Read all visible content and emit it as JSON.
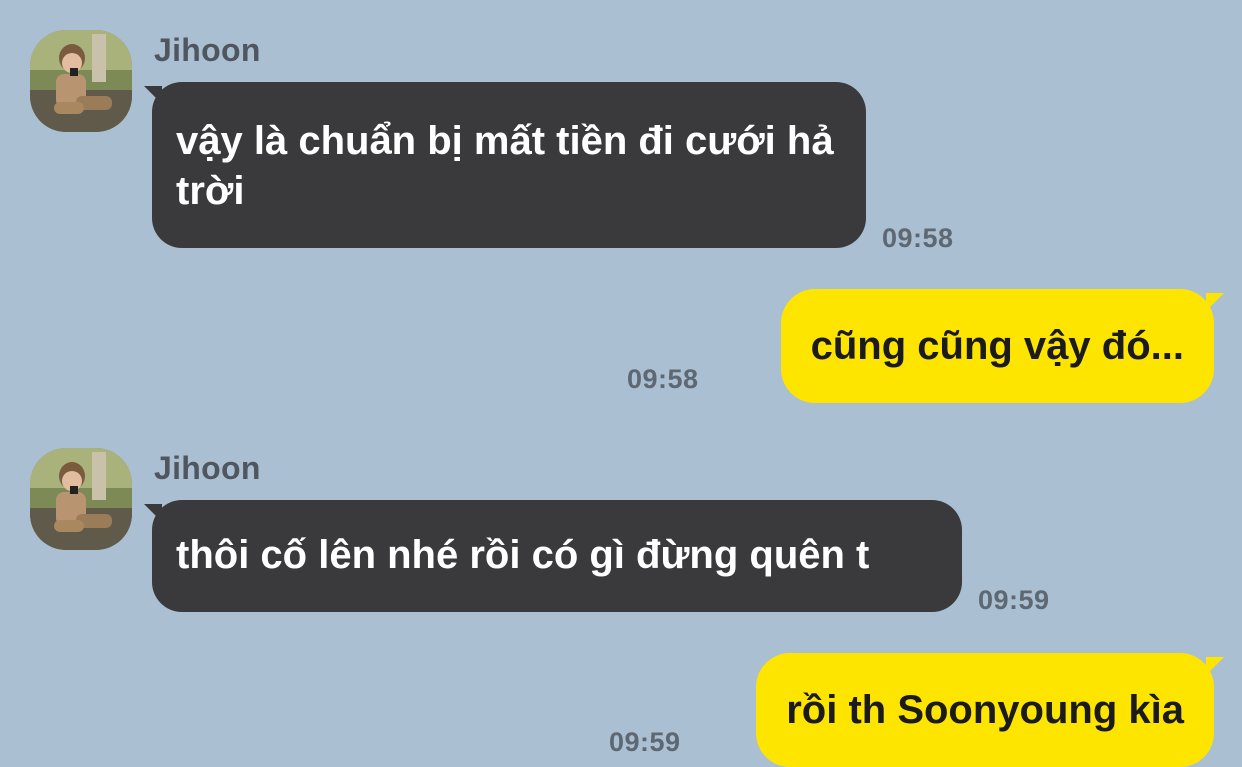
{
  "conversation": [
    {
      "direction": "incoming",
      "sender": "Jihoon",
      "text": "vậy là chuẩn bị mất tiền đi cưới hả trời",
      "time": "09:58"
    },
    {
      "direction": "outgoing",
      "text": "cũng cũng vậy đó...",
      "time": "09:58"
    },
    {
      "direction": "incoming",
      "sender": "Jihoon",
      "text": "thôi cố lên nhé rồi có gì đừng quên t",
      "time": "09:59"
    },
    {
      "direction": "outgoing",
      "text": "rồi th Soonyoung kìa",
      "time": "09:59"
    }
  ],
  "colors": {
    "background": "#aabfd1",
    "incoming_bubble": "#3a3a3c",
    "outgoing_bubble": "#fee500",
    "timestamp": "#5d6873"
  },
  "icons": {
    "avatar": "profile-photo"
  }
}
